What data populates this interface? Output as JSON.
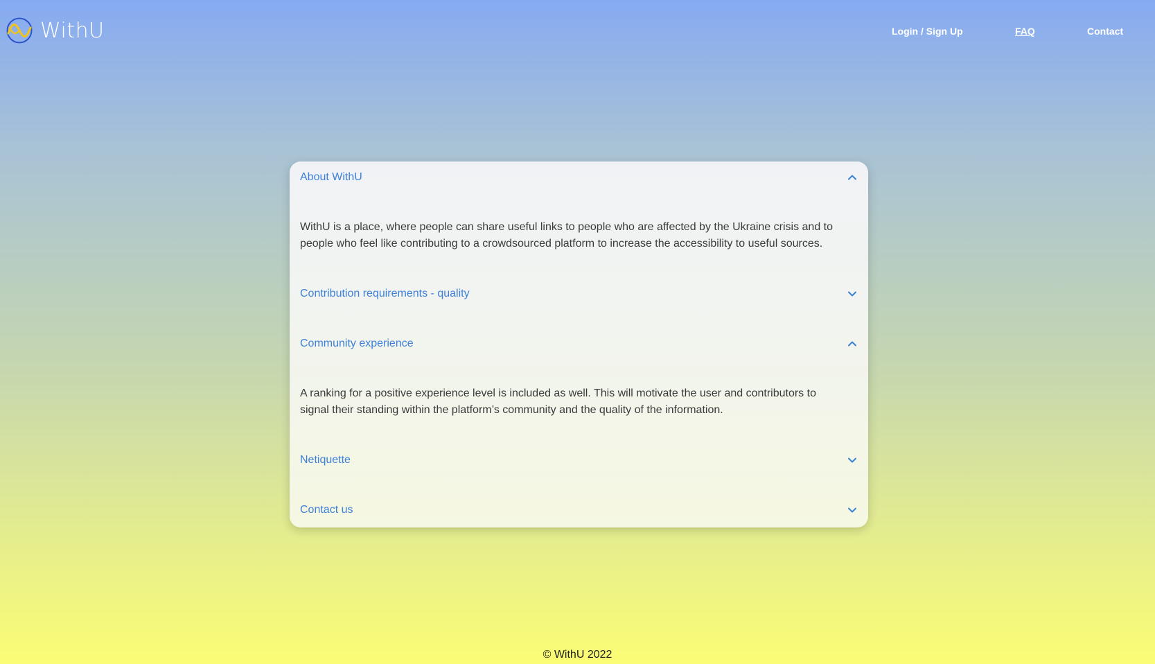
{
  "brand": {
    "name": "WithU",
    "logo_icon": "withu-logo-icon"
  },
  "nav": {
    "login": "Login / Sign Up",
    "faq": "FAQ",
    "contact": "Contact"
  },
  "faq": {
    "items": [
      {
        "title": "About WithU",
        "expanded": true,
        "icon": "chevron-up-icon",
        "body": "WithU is a place, where people can share useful links to people who are affected by the Ukraine crisis and to people who feel like contributing to a crowdsourced platform to increase the accessibility to useful sources."
      },
      {
        "title": "Contribution requirements - quality",
        "expanded": false,
        "icon": "chevron-down-icon"
      },
      {
        "title": "Community experience",
        "expanded": true,
        "icon": "chevron-up-icon",
        "body": "A ranking for a positive experience level is included as well. This will motivate the user and contributors to signal their standing within the platform’s community and the quality of the information."
      },
      {
        "title": "Netiquette",
        "expanded": false,
        "icon": "chevron-down-icon"
      },
      {
        "title": "Contact us",
        "expanded": false,
        "icon": "chevron-down-icon"
      }
    ]
  },
  "footer": {
    "text": "© WithU 2022"
  },
  "colors": {
    "accent": "#3d80d8",
    "gradient_top": "#86aaf2",
    "gradient_bottom": "#fbfd74"
  }
}
